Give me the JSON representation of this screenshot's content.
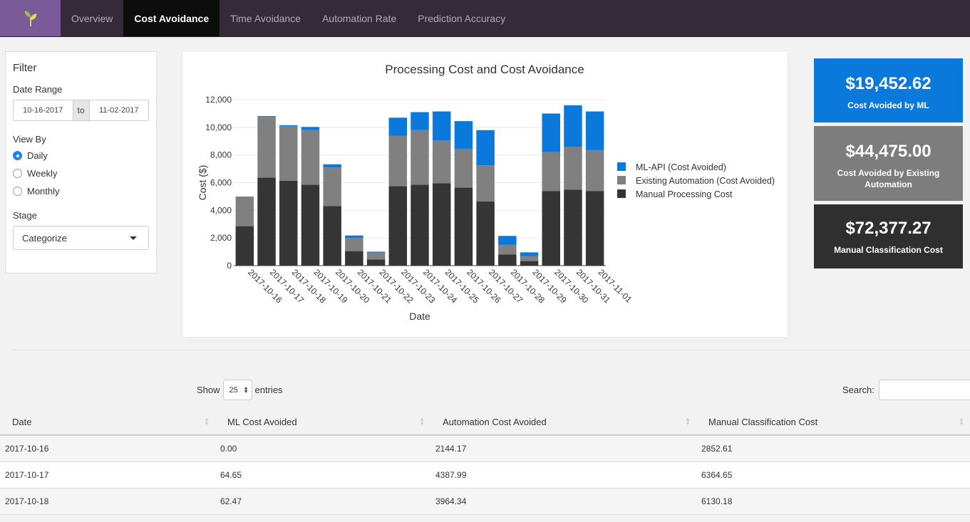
{
  "nav": {
    "tabs": [
      "Overview",
      "Cost Avoidance",
      "Time Avoidance",
      "Automation Rate",
      "Prediction Accuracy"
    ],
    "active_tab": "Cost Avoidance"
  },
  "filter": {
    "title": "Filter",
    "date_range_label": "Date Range",
    "start_date": "10-16-2017",
    "to_label": "to",
    "end_date": "11-02-2017",
    "view_by_label": "View By",
    "view_options": [
      "Daily",
      "Weekly",
      "Monthly"
    ],
    "view_selected": "Daily",
    "stage_label": "Stage",
    "stage_value": "Categorize"
  },
  "kpis": {
    "ml": {
      "value": "$19,452.62",
      "label": "Cost Avoided by ML"
    },
    "existing": {
      "value": "$44,475.00",
      "label": "Cost Avoided by Existing Automation"
    },
    "manual": {
      "value": "$72,377.27",
      "label": "Manual Classification Cost"
    }
  },
  "colors": {
    "ml": "#0b78dc",
    "existing": "#808080",
    "manual": "#353535",
    "kpi_existing": "#7d7d7d",
    "kpi_manual": "#2f2f2f"
  },
  "chart_data": {
    "type": "bar",
    "stacked": true,
    "title": "Processing Cost and Cost Avoidance",
    "xlabel": "Date",
    "ylabel": "Cost ($)",
    "ylim": [
      0,
      12000
    ],
    "yticks": [
      "0",
      "2,000",
      "4,000",
      "6,000",
      "8,000",
      "10,000",
      "12,000"
    ],
    "ytick_values": [
      0,
      2000,
      4000,
      6000,
      8000,
      10000,
      12000
    ],
    "grid": true,
    "legend_position": "right",
    "categories": [
      "2017-10-16",
      "2017-10-17",
      "2017-10-18",
      "2017-10-19",
      "2017-10-20",
      "2017-10-21",
      "2017-10-22",
      "2017-10-23",
      "2017-10-24",
      "2017-10-25",
      "2017-10-26",
      "2017-10-27",
      "2017-10-28",
      "2017-10-29",
      "2017-10-30",
      "2017-10-31",
      "2017-11-01"
    ],
    "series": [
      {
        "name": "ML-API (Cost Avoided)",
        "color": "#0b78dc",
        "values": [
          0.0,
          64.65,
          62.47,
          230,
          230,
          180,
          60,
          1300,
          1300,
          2100,
          2000,
          2550,
          650,
          280,
          2800,
          3000,
          2800
        ]
      },
      {
        "name": "Existing Automation (Cost Avoided)",
        "color": "#808080",
        "values": [
          2144.17,
          4387.99,
          3964.34,
          3950,
          2800,
          950,
          500,
          3650,
          3950,
          3100,
          2800,
          2600,
          700,
          350,
          2800,
          3100,
          2950
        ]
      },
      {
        "name": "Manual Processing Cost",
        "color": "#353535",
        "values": [
          2852.61,
          6364.65,
          6130.18,
          5850,
          4300,
          1050,
          450,
          5750,
          5850,
          5950,
          5650,
          4650,
          800,
          330,
          5400,
          5500,
          5400
        ]
      }
    ]
  },
  "table_controls": {
    "show_label": "Show",
    "entries_value": "25",
    "entries_label": "entries",
    "search_label": "Search:"
  },
  "table": {
    "columns": [
      "Date",
      "ML Cost Avoided",
      "Automation Cost Avoided",
      "Manual Classification Cost"
    ],
    "rows": [
      [
        "2017-10-16",
        "0.00",
        "2144.17",
        "2852.61"
      ],
      [
        "2017-10-17",
        "64.65",
        "4387.99",
        "6364.65"
      ],
      [
        "2017-10-18",
        "62.47",
        "3964.34",
        "6130.18"
      ]
    ]
  }
}
